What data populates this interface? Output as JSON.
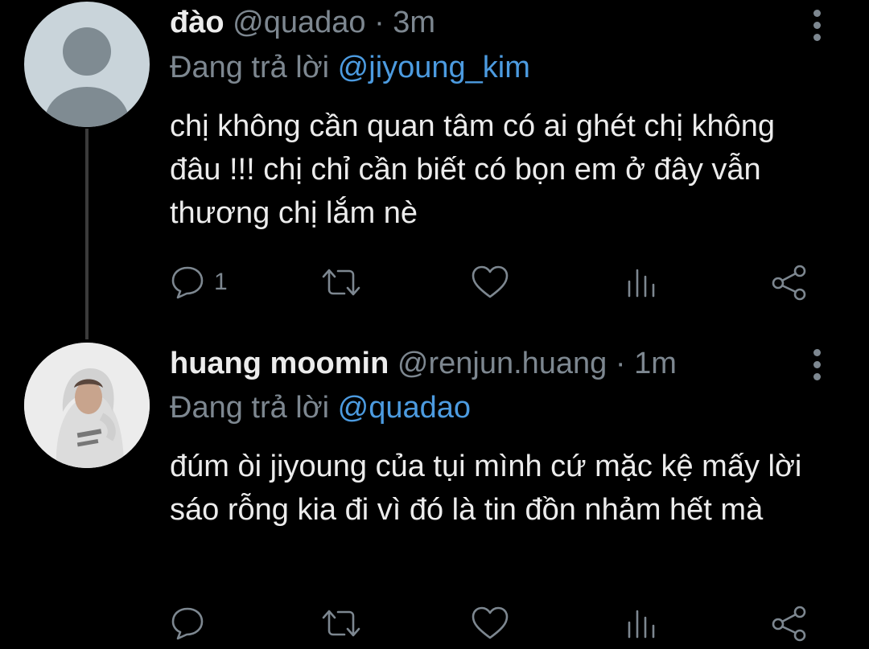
{
  "tweets": [
    {
      "name": "đào",
      "handle": "@quadao",
      "separator": "·",
      "time": "3m",
      "reply_prefix": "Đang trả lời",
      "reply_to": "@jiyoung_kim",
      "text": "chị không cần quan tâm có ai ghét chị không đâu !!! chị chỉ cần biết có bọn em ở đây vẫn thương chị lắm nè",
      "reply_count": "1",
      "avatar_icon": "default-avatar-icon"
    },
    {
      "name": "huang moomin",
      "handle": "@renjun.huang",
      "separator": "·",
      "time": "1m",
      "reply_prefix": "Đang trả lời",
      "reply_to": "@quadao",
      "text": "đúm òi jiyoung của tụi mình cứ mặc kệ mấy lời sáo rỗng kia đi vì đó là tin đồn nhảm hết mà",
      "reply_count": "",
      "avatar_icon": "user-photo-avatar"
    }
  ],
  "colors": {
    "background": "#000000",
    "text": "#ececec",
    "muted": "#7d8790",
    "mention": "#4c9be0",
    "thread_line": "#3b3b3b"
  }
}
